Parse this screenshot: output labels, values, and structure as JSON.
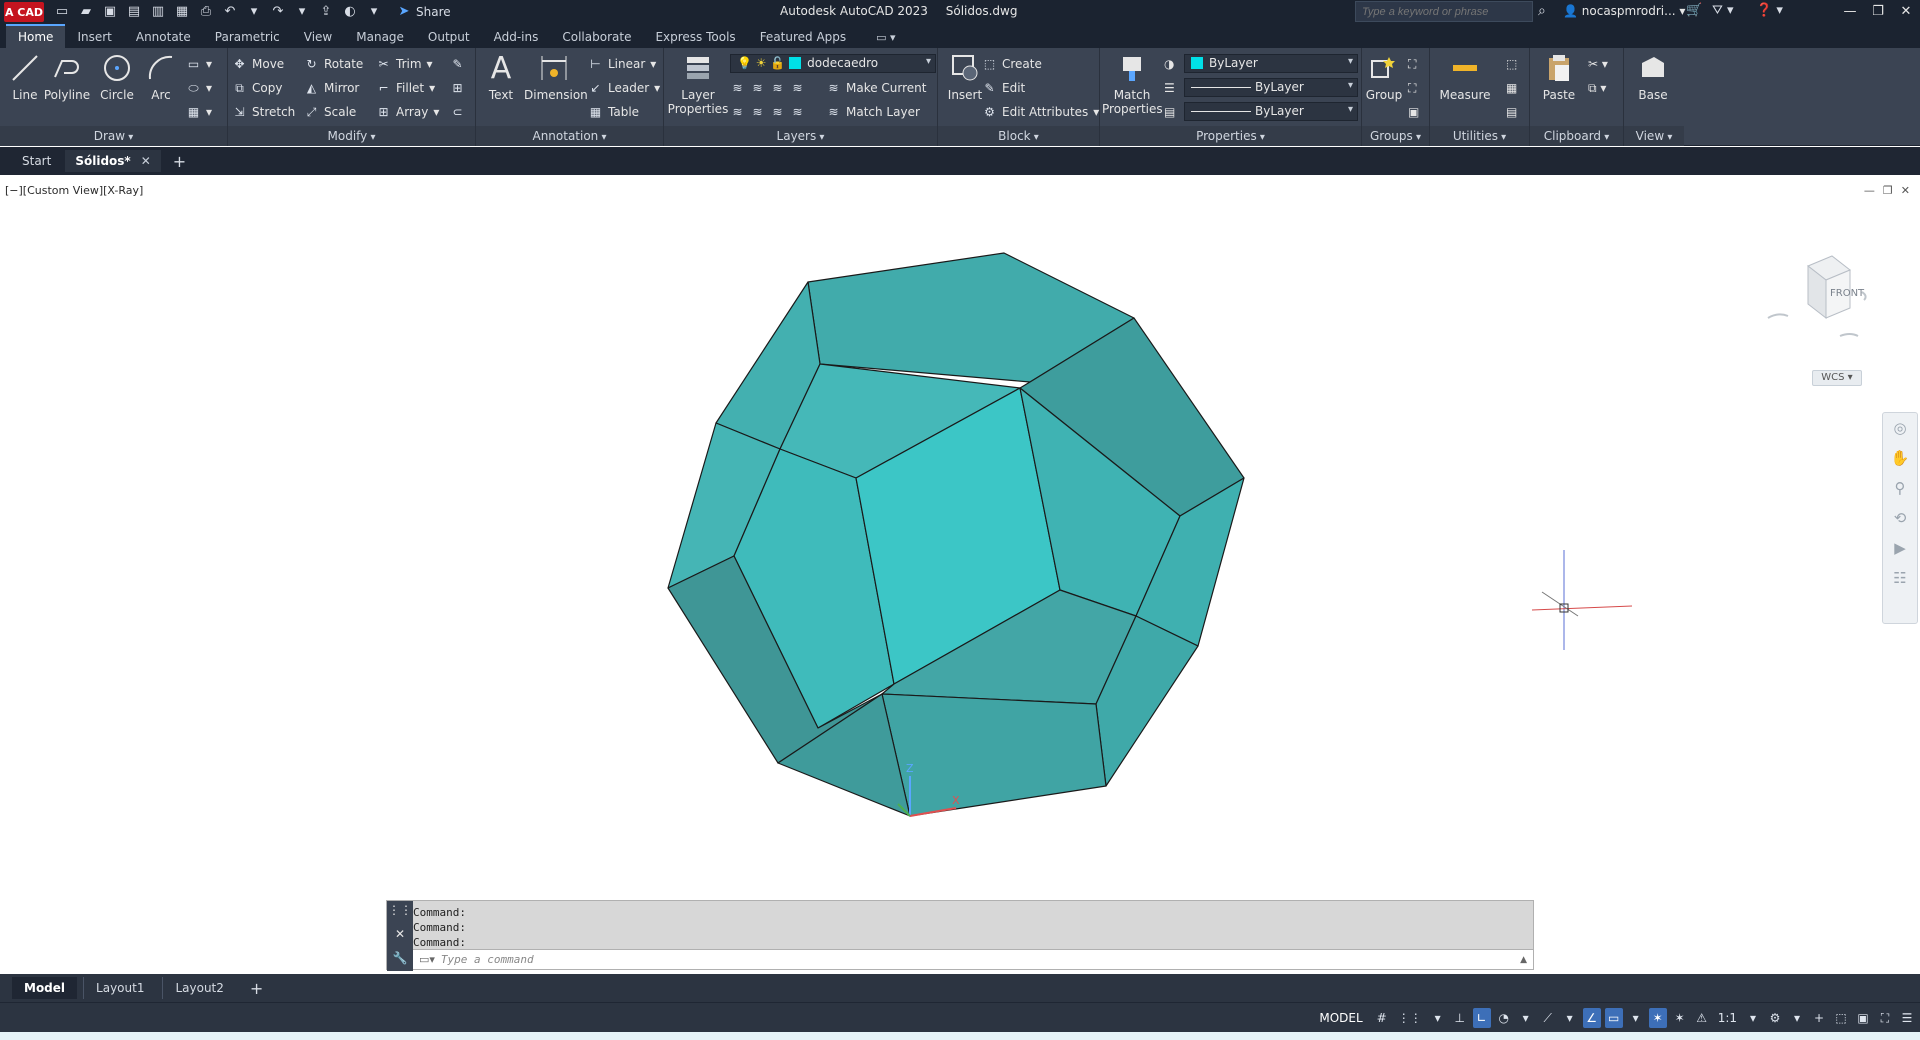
{
  "title_bar": {
    "logo": "A CAD",
    "app_name": "Autodesk AutoCAD 2023",
    "file_name": "Sólidos.dwg",
    "share_label": "Share",
    "search_placeholder": "Type a keyword or phrase",
    "user_name": "nocaspmrodri..."
  },
  "ribbon_tabs": [
    {
      "label": "Home"
    },
    {
      "label": "Insert"
    },
    {
      "label": "Annotate"
    },
    {
      "label": "Parametric"
    },
    {
      "label": "View"
    },
    {
      "label": "Manage"
    },
    {
      "label": "Output"
    },
    {
      "label": "Add-ins"
    },
    {
      "label": "Collaborate"
    },
    {
      "label": "Express Tools"
    },
    {
      "label": "Featured Apps"
    }
  ],
  "ribbon": {
    "draw": {
      "title": "Draw",
      "line": "Line",
      "polyline": "Polyline",
      "circle": "Circle",
      "arc": "Arc"
    },
    "modify": {
      "title": "Modify",
      "move": "Move",
      "rotate": "Rotate",
      "trim": "Trim",
      "copy": "Copy",
      "mirror": "Mirror",
      "fillet": "Fillet",
      "stretch": "Stretch",
      "scale": "Scale",
      "array": "Array"
    },
    "annotation": {
      "title": "Annotation",
      "text": "Text",
      "dimension": "Dimension",
      "linear": "Linear",
      "leader": "Leader",
      "table": "Table"
    },
    "layers": {
      "title": "Layers",
      "layer_properties": "Layer Properties",
      "current_layer": "dodecaedro",
      "make_current": "Make Current",
      "match_layer": "Match Layer"
    },
    "block": {
      "title": "Block",
      "insert": "Insert",
      "create": "Create",
      "edit": "Edit",
      "edit_attributes": "Edit Attributes"
    },
    "properties": {
      "title": "Properties",
      "match_properties": "Match Properties",
      "color": "ByLayer",
      "linetype": "ByLayer",
      "lineweight": "ByLayer"
    },
    "groups": {
      "title": "Groups",
      "group": "Group"
    },
    "utilities": {
      "title": "Utilities",
      "measure": "Measure"
    },
    "clipboard": {
      "title": "Clipboard",
      "paste": "Paste"
    },
    "view": {
      "title": "View",
      "base": "Base"
    }
  },
  "file_tabs": {
    "start": "Start",
    "active": "Sólidos*"
  },
  "viewport": {
    "label": "[−][Custom View][X-Ray]",
    "viewcube_face": "FRONT",
    "wcs": "WCS"
  },
  "command_line": {
    "history": [
      "Command:",
      "Command:",
      "Command:"
    ],
    "placeholder": "Type a command"
  },
  "layout_tabs": [
    "Model",
    "Layout1",
    "Layout2"
  ],
  "status_bar": {
    "model": "MODEL",
    "scale": "1:1"
  },
  "colors": {
    "ui_dark": "#3b4453",
    "titlebar": "#1b2330",
    "accent": "#5aa6ff",
    "solid_face": "#3fbfbf",
    "layer_swatch": "#00e0e8"
  }
}
